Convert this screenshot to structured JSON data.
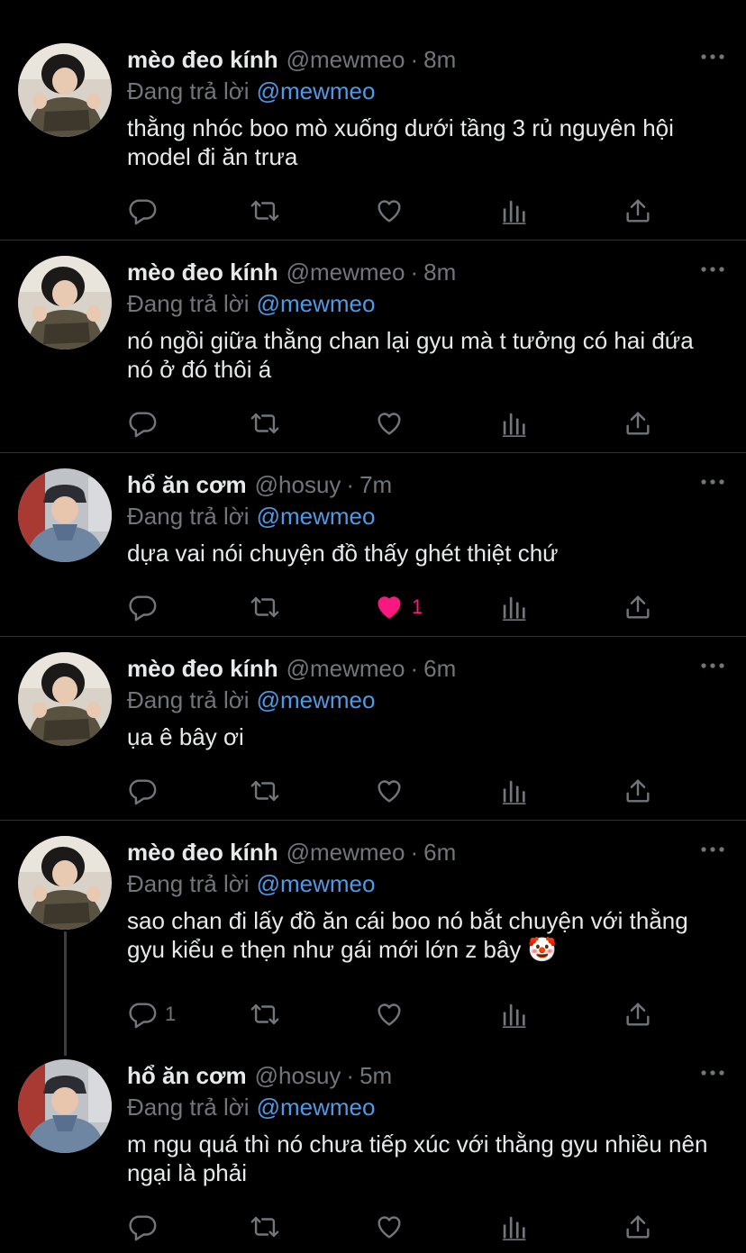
{
  "reply_prefix": "Đang trả lời",
  "colors": {
    "background": "#000000",
    "mention": "#4c9ae8",
    "liked": "#f91880",
    "muted": "#71767b"
  },
  "tweets": [
    {
      "avatar": "avatar-meo",
      "name": "mèo đeo kính",
      "handle": "@mewmeo",
      "time": "8m",
      "replying_to": "@mewmeo",
      "text": "thằng nhóc boo mò xuống dưới tầng 3 rủ nguyên hội model đi ăn trưa",
      "reply_count": "",
      "like_count": "",
      "liked": false
    },
    {
      "avatar": "avatar-meo",
      "name": "mèo đeo kính",
      "handle": "@mewmeo",
      "time": "8m",
      "replying_to": "@mewmeo",
      "text": "nó ngồi giữa thằng chan lại gyu mà t tưởng có hai đứa nó ở đó thôi á",
      "reply_count": "",
      "like_count": "",
      "liked": false
    },
    {
      "avatar": "avatar-ho",
      "name": "hổ ăn cơm",
      "handle": "@hosuy",
      "time": "7m",
      "replying_to": "@mewmeo",
      "text": "dựa vai nói chuyện đồ thấy ghét thiệt chứ",
      "reply_count": "",
      "like_count": "1",
      "liked": true
    },
    {
      "avatar": "avatar-meo",
      "name": "mèo đeo kính",
      "handle": "@mewmeo",
      "time": "6m",
      "replying_to": "@mewmeo",
      "text": "ụa ê bây ơi",
      "reply_count": "",
      "like_count": "",
      "liked": false
    },
    {
      "avatar": "avatar-meo",
      "name": "mèo đeo kính",
      "handle": "@mewmeo",
      "time": "6m",
      "replying_to": "@mewmeo",
      "text": "sao chan đi lấy đồ ăn cái boo nó bắt chuyện với thằng gyu kiểu e thẹn như gái mới lớn z bây 🤡",
      "reply_count": "1",
      "like_count": "",
      "liked": false
    },
    {
      "avatar": "avatar-ho",
      "name": "hổ ăn cơm",
      "handle": "@hosuy",
      "time": "5m",
      "replying_to": "@mewmeo",
      "text": "m ngu quá thì nó chưa tiếp xúc với thằng gyu nhiều nên ngại là phải",
      "reply_count": "",
      "like_count": "",
      "liked": false
    }
  ]
}
